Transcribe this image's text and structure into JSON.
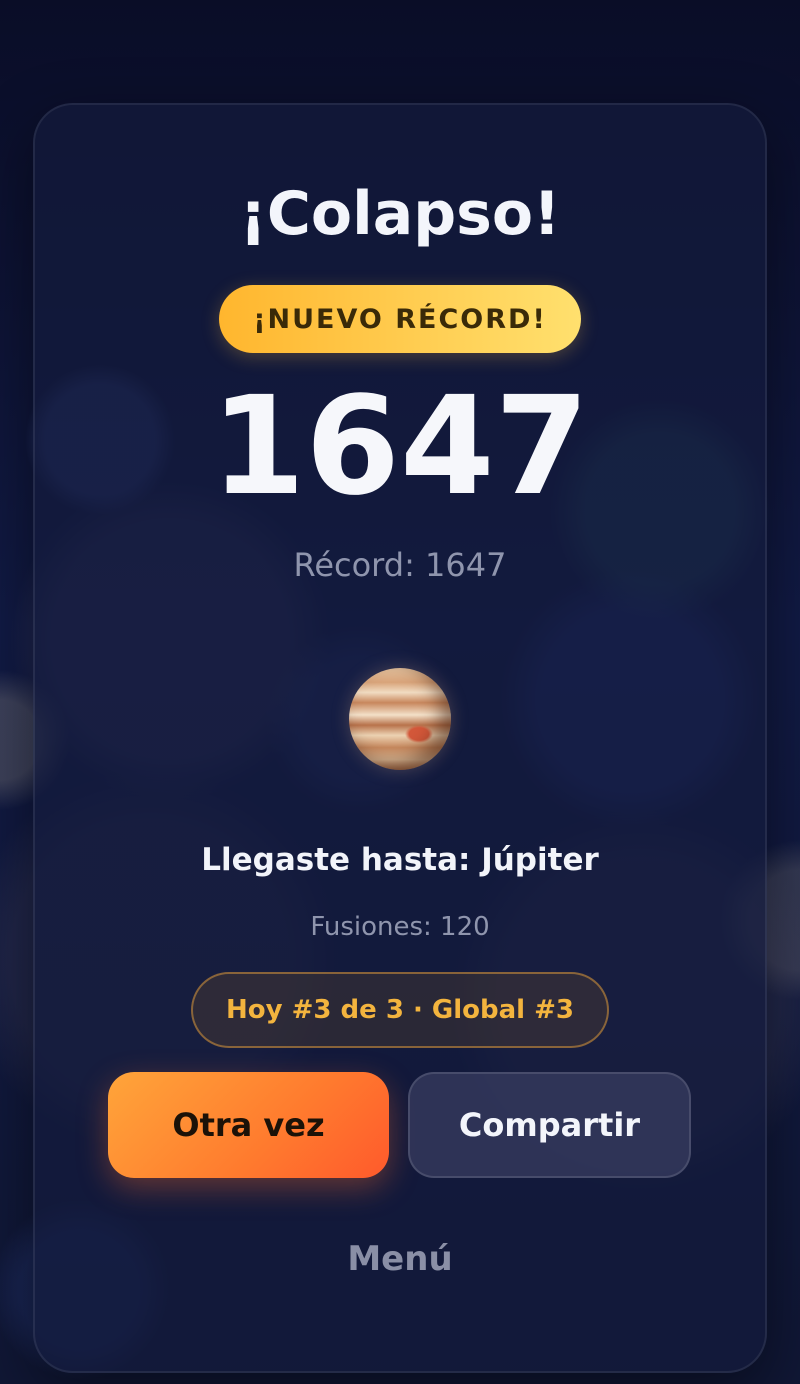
{
  "result": {
    "title": "¡Colapso!",
    "badge": "¡NUEVO RÉCORD!",
    "score": "1647",
    "record_line": "Récord: 1647"
  },
  "planet": {
    "icon": "jupiter-icon",
    "reached_line": "Llegaste hasta: Júpiter"
  },
  "stats": {
    "fusions_line": "Fusiones: 120",
    "rank_line": "Hoy #3 de 3 · Global #3"
  },
  "actions": {
    "again_label": "Otra vez",
    "share_label": "Compartir",
    "menu_label": "Menú"
  },
  "colors": {
    "badge_gradient": [
      "#ffb62e",
      "#ffe06e"
    ],
    "primary_button": "#ff7a2e",
    "rank_text": "#f3b43e",
    "background": "#0b0f2a"
  }
}
